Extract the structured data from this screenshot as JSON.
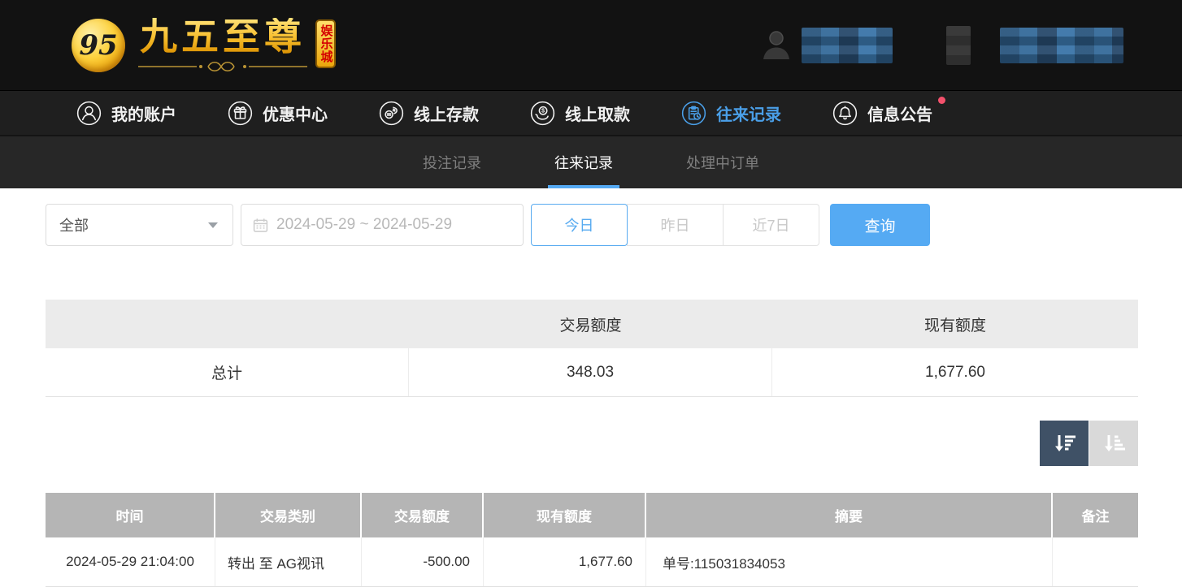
{
  "brand": {
    "logo_number": "95",
    "logo_name": "九五至尊",
    "badge_chars": "娱乐城"
  },
  "nav": {
    "items": [
      {
        "label": "我的账户",
        "icon": "user-icon",
        "active": false
      },
      {
        "label": "优惠中心",
        "icon": "gift-icon",
        "active": false
      },
      {
        "label": "线上存款",
        "icon": "deposit-icon",
        "active": false
      },
      {
        "label": "线上取款",
        "icon": "withdraw-icon",
        "active": false
      },
      {
        "label": "往来记录",
        "icon": "records-icon",
        "active": true
      },
      {
        "label": "信息公告",
        "icon": "bell-icon",
        "active": false,
        "has_notification_dot": true
      }
    ]
  },
  "tabs": [
    {
      "label": "投注记录",
      "active": false
    },
    {
      "label": "往来记录",
      "active": true
    },
    {
      "label": "处理中订单",
      "active": false
    }
  ],
  "filters": {
    "type_value": "全部",
    "date_range": "2024-05-29 ~ 2024-05-29",
    "quick_buttons": [
      {
        "label": "今日",
        "active": true
      },
      {
        "label": "昨日",
        "active": false
      },
      {
        "label": "近7日",
        "active": false
      }
    ],
    "query_label": "查询"
  },
  "summary": {
    "col_headers": [
      "",
      "交易额度",
      "现有额度"
    ],
    "row": {
      "label": "总计",
      "trade_amount": "348.03",
      "balance": "1,677.60"
    }
  },
  "sort": {
    "desc_icon": "sort-amount-desc-icon",
    "asc_icon": "sort-amount-asc-icon"
  },
  "records_table": {
    "columns": [
      "时间",
      "交易类别",
      "交易额度",
      "现有额度",
      "摘要",
      "备注"
    ],
    "rows": [
      {
        "time": "2024-05-29 21:04:00",
        "type": "转出 至 AG视讯",
        "amount": "-500.00",
        "balance": "1,677.60",
        "summary": "单号:115031834053",
        "note": ""
      }
    ]
  },
  "colors": {
    "accent_blue": "#55aaf3",
    "nav_active_blue": "#4a9fe8",
    "notification_dot": "#f4516c",
    "records_header_bg": "#b5b5b5",
    "summary_header_bg": "#ebebeb",
    "sort_active_bg": "#3f5166",
    "sort_inactive_bg": "#d9d9d9",
    "brand_gold": "#f3b81f",
    "badge_text_red": "#d40000"
  }
}
